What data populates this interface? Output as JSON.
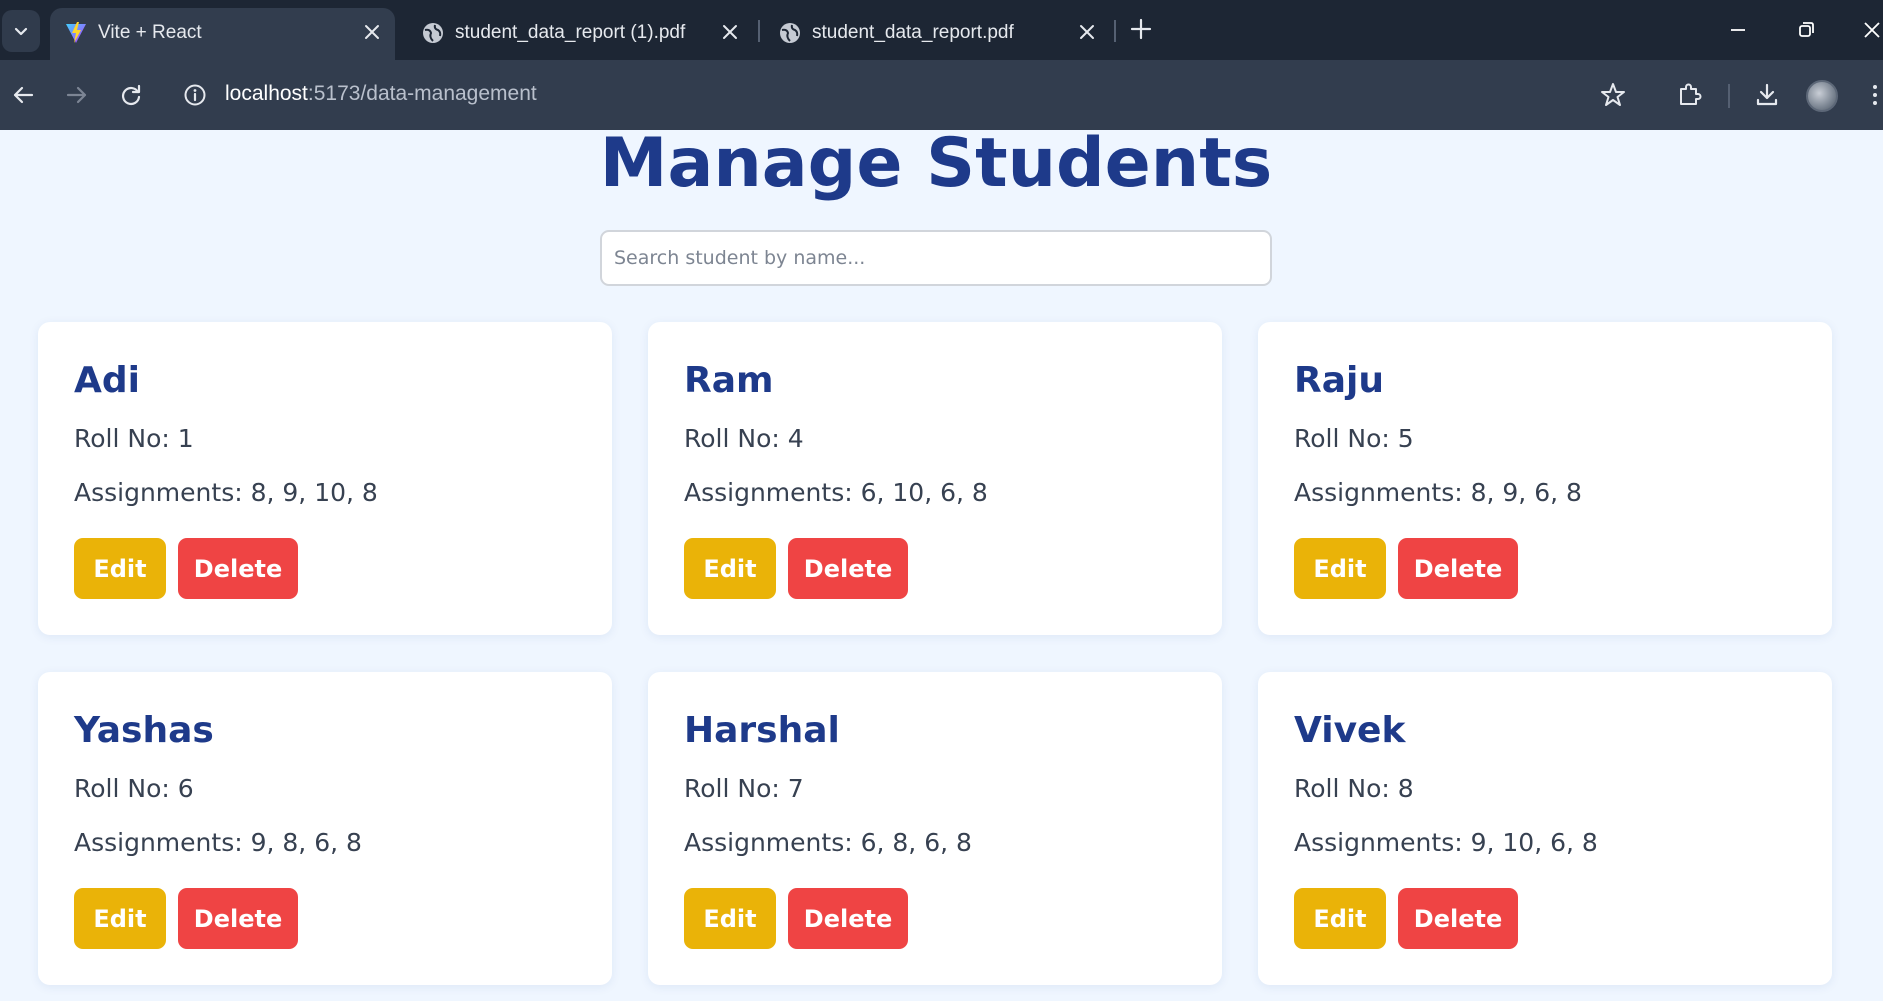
{
  "browser": {
    "tabs": [
      {
        "title": "Vite + React",
        "active": true,
        "icon": "vite-icon"
      },
      {
        "title": "student_data_report (1).pdf",
        "active": false,
        "icon": "globe-icon"
      },
      {
        "title": "student_data_report.pdf",
        "active": false,
        "icon": "globe-icon"
      }
    ],
    "url_host": "localhost",
    "url_path": ":5173/data-management"
  },
  "page": {
    "title": "Manage Students",
    "search_placeholder": "Search student by name...",
    "search_value": "",
    "edit_label": "Edit",
    "delete_label": "Delete",
    "roll_prefix": "Roll No: ",
    "assign_prefix": "Assignments: "
  },
  "students": [
    {
      "name": "Adi",
      "roll": "1",
      "assignments": "8, 9, 10, 8"
    },
    {
      "name": "Ram",
      "roll": "4",
      "assignments": "6, 10, 6, 8"
    },
    {
      "name": "Raju",
      "roll": "5",
      "assignments": "8, 9, 6, 8"
    },
    {
      "name": "Yashas",
      "roll": "6",
      "assignments": "9, 8, 6, 8"
    },
    {
      "name": "Harshal",
      "roll": "7",
      "assignments": "6, 8, 6, 8"
    },
    {
      "name": "Vivek",
      "roll": "8",
      "assignments": "9, 10, 6, 8"
    }
  ],
  "colors": {
    "accent_title": "#1e3a8a",
    "edit_button": "#eab308",
    "delete_button": "#ef4444",
    "page_background": "#eff6ff"
  }
}
